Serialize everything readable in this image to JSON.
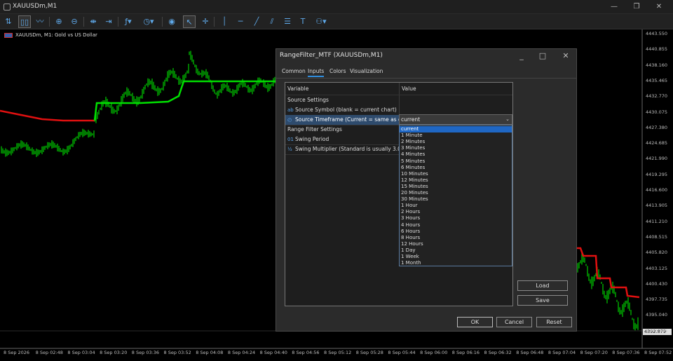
{
  "window": {
    "title": "XAUUSDm,M1"
  },
  "toolbar": {
    "icons": [
      "trades-icon",
      "bar-chart-icon",
      "candles-icon",
      "line-chart-icon",
      "zoom-in-icon",
      "zoom-out-icon",
      "tile-icon",
      "autoscroll-icon",
      "indicators-icon",
      "periods-icon",
      "screenshot-icon",
      "cursor-icon",
      "crosshair-icon",
      "vertical-line-icon",
      "horizontal-line-icon",
      "trend-line-icon",
      "channel-icon",
      "fibo-icon",
      "text-icon",
      "shapes-icon"
    ]
  },
  "chart": {
    "label": "XAUUSDm, M1:  Gold vs US Dollar",
    "price_ticks": [
      "4443.550",
      "4440.855",
      "4438.160",
      "4435.465",
      "4432.770",
      "4430.075",
      "4427.380",
      "4424.685",
      "4421.990",
      "4419.295",
      "4416.600",
      "4413.905",
      "4411.210",
      "4408.515",
      "4405.820",
      "4403.125",
      "4400.430",
      "4397.735",
      "4395.040",
      "4392.345"
    ],
    "current_price": "4392.879",
    "time_ticks": [
      "8 Sep 2026",
      "8 Sep 02:48",
      "8 Sep 03:04",
      "8 Sep 03:20",
      "8 Sep 03:36",
      "8 Sep 03:52",
      "8 Sep 04:08",
      "8 Sep 04:24",
      "8 Sep 04:40",
      "8 Sep 04:56",
      "8 Sep 05:12",
      "8 Sep 05:28",
      "8 Sep 05:44",
      "8 Sep 06:00",
      "8 Sep 06:16",
      "8 Sep 06:32",
      "8 Sep 06:48",
      "8 Sep 07:04",
      "8 Sep 07:20",
      "8 Sep 07:36",
      "8 Sep 07:52"
    ],
    "colors": {
      "bull_line": "#00e000",
      "bear_line": "#e01010",
      "candles": "#00cc00"
    }
  },
  "dialog": {
    "title": "RangeFilter_MTF (XAUUSDm,M1)",
    "tabs": [
      "Common",
      "Inputs",
      "Colors",
      "Visualization"
    ],
    "active_tab": "Inputs",
    "grid": {
      "col_variable": "Variable",
      "col_value": "Value",
      "rows": [
        {
          "label": "Source Settings",
          "icon": ""
        },
        {
          "label": "Source Symbol (blank = current chart)",
          "icon": "ab"
        },
        {
          "label": "Source Timeframe (Current = same as c...",
          "icon": "◴"
        },
        {
          "label": "Range Filter Settings",
          "icon": ""
        },
        {
          "label": "Swing Period",
          "icon": "01"
        },
        {
          "label": "Swing Multiplier (Standard is usually 3.0)",
          "icon": "½"
        }
      ]
    },
    "timeframe": {
      "value": "current",
      "options": [
        "current",
        "1 Minute",
        "2 Minutes",
        "3 Minutes",
        "4 Minutes",
        "5 Minutes",
        "6 Minutes",
        "10 Minutes",
        "12 Minutes",
        "15 Minutes",
        "20 Minutes",
        "30 Minutes",
        "1 Hour",
        "2 Hours",
        "3 Hours",
        "4 Hours",
        "6 Hours",
        "8 Hours",
        "12 Hours",
        "1 Day",
        "1 Week",
        "1 Month"
      ]
    },
    "buttons": {
      "load": "Load",
      "save": "Save",
      "ok": "OK",
      "cancel": "Cancel",
      "reset": "Reset"
    }
  }
}
